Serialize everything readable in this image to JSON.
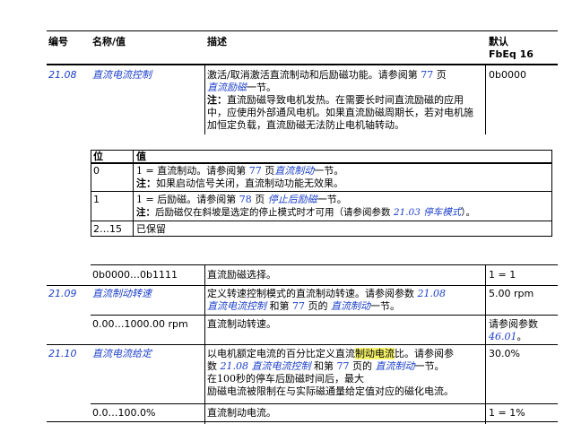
{
  "header": {
    "col_no": "编号",
    "col_name": "名称/值",
    "col_desc": "描述",
    "col_default_line1": "默认",
    "col_default_line2": "FbEq 16"
  },
  "p2108": {
    "no": "21.08",
    "name": "直流电流控制",
    "desc_a": "激活/取消激活直流制动和后励磁功能。请参阅第 ",
    "desc_page": "77",
    "desc_b": " 页",
    "desc_link": "直流励磁",
    "desc_c": "一节。",
    "note_label": "注：",
    "note_text": "直流励磁导致电机发热。在需要长时间直流励磁的应用中，应使用外部通风电机。如果直流励磁周期长，若对电机施加恒定负载，直流励磁无法防止电机轴转动。",
    "default": "0b0000"
  },
  "bits": {
    "col_bit": "位",
    "col_value": "值",
    "rows": [
      {
        "bit": "0",
        "l1_a": "1 = 直流制动。请参阅第 ",
        "l1_page": "77",
        "l1_b": " 页",
        "l1_link": "直流制动",
        "l1_c": "一节。",
        "note_label": "注：",
        "note_text": "如果启动信号关闭，直流制动功能无效果。"
      },
      {
        "bit": "1",
        "l1_a": "1 = 后励磁。请参阅第 ",
        "l1_page": "78",
        "l1_b": " 页 ",
        "l1_link": "停止后励磁",
        "l1_c": "一节。",
        "note_label": "注：",
        "note_text": "后励磁仅在斜坡是选定的停止模式时才可用（请参阅参数 ",
        "note_param": "21.03",
        "note_param_link": "停车模式",
        "note_end": "）。"
      },
      {
        "bit": "2…15",
        "value": "已保留"
      }
    ]
  },
  "range2108": {
    "range": "0b0000…0b1111",
    "desc": "直流励磁选择。",
    "default": "1 = 1"
  },
  "p2109": {
    "no": "21.09",
    "name": "直流制动转速",
    "desc_a": "定义转速控制模式的直流制动转速。请参阅参数 ",
    "desc_param": "21.08",
    "desc_param_link": "直流电流控制",
    "desc_b": " 和第 ",
    "desc_page": "77",
    "desc_c": " 页的 ",
    "desc_link": "直流制动",
    "desc_d": "一节。",
    "default": "5.00 rpm"
  },
  "range2109": {
    "range": "0.00…1000.00 rpm",
    "desc": "直流制动转速。",
    "default_a": "请参阅参数",
    "default_param": "46.01",
    "default_b": "。"
  },
  "p2110": {
    "no": "21.10",
    "name": "直流电流给定",
    "l1_a": "以电机额定电流的百分比定义直流",
    "l1_hi": "制动电流",
    "l1_b": "比。请参阅参",
    "l2_a": "数 ",
    "l2_param": "21.08",
    "l2_param_link": "直流电流控制",
    "l2_b": " 和第 ",
    "l2_page": "77",
    "l2_c": " 页的 ",
    "l2_link": "直流制动",
    "l2_d": "一节。",
    "l3": "在100秒的停车后励磁时间后，最大",
    "l4": "励磁电流被限制在与实际磁通量给定值对应的磁化电流。",
    "default": "30.0%"
  },
  "range2110": {
    "range": "0.0…100.0%",
    "desc": "直流制动电流。",
    "default": "1 = 1%"
  }
}
